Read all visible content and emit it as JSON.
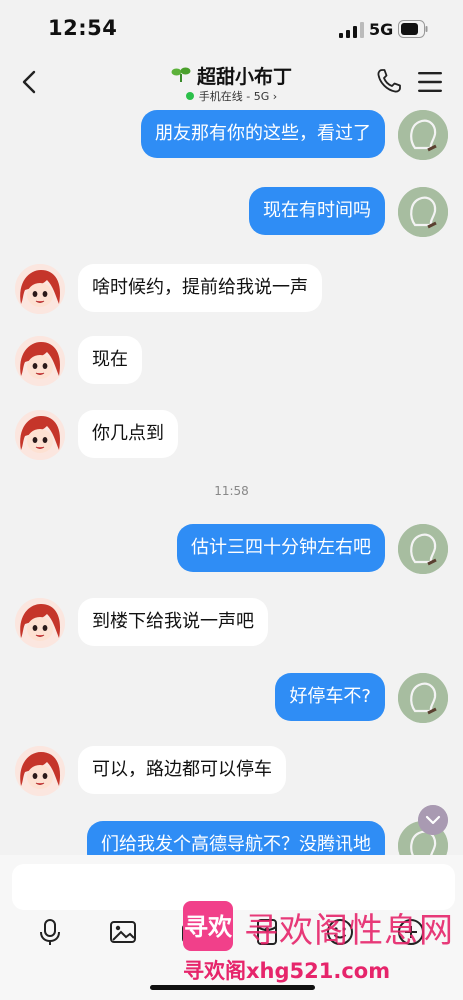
{
  "status_bar": {
    "time": "12:54",
    "network": "5G"
  },
  "header": {
    "title": "超甜小布丁",
    "status_text": "手机在线 - 5G",
    "status_chevron": "›",
    "icons": [
      "back-icon",
      "sprout-icon",
      "phone-icon",
      "menu-icon"
    ]
  },
  "messages": [
    {
      "from": "self",
      "text": "朋友那有你的这些，看过了"
    },
    {
      "from": "self",
      "text": "现在有时间吗"
    },
    {
      "from": "peer",
      "text": "啥时候约，提前给我说一声"
    },
    {
      "from": "peer",
      "text": "现在"
    },
    {
      "from": "peer",
      "text": "你几点到"
    },
    {
      "from": "time",
      "text": "11:58"
    },
    {
      "from": "self",
      "text": "估计三四十分钟左右吧"
    },
    {
      "from": "peer",
      "text": "到楼下给我说一声吧"
    },
    {
      "from": "self",
      "text": "好停车不?"
    },
    {
      "from": "peer",
      "text": "可以，路边都可以停车"
    },
    {
      "from": "self",
      "text": "们给我发个高德导航不？没腾讯地"
    }
  ],
  "input": {
    "placeholder": ""
  },
  "toolbar": [
    "microphone-icon",
    "image-icon",
    "camera-icon",
    "red-packet-icon",
    "emoji-icon",
    "plus-icon"
  ],
  "watermark": {
    "logo_text": "寻欢",
    "name": "寻欢阁性息网",
    "url": "寻欢阁xhg521.com"
  },
  "colors": {
    "self_bubble": "#2f8df5",
    "peer_bubble": "#ffffff",
    "background": "#f2f2f2",
    "watermark": "#e6256b"
  }
}
